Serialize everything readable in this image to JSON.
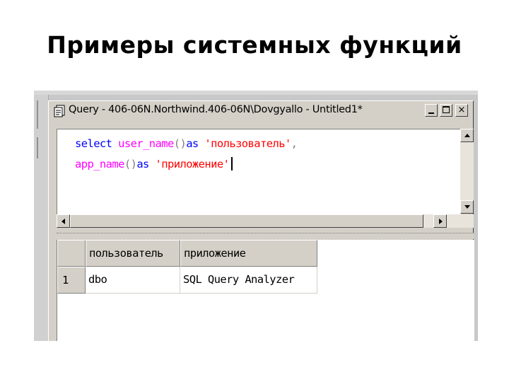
{
  "slide": {
    "title": "Примеры системных функций"
  },
  "window": {
    "title": "Query - 406-06N.Northwind.406-06N\\Dovgyallo - Untitled1*",
    "controls": {
      "minimize": "_",
      "maximize": "□",
      "close": "×"
    }
  },
  "editor": {
    "line1": {
      "kw1": "select",
      "fn1": "user_name",
      "paren1": "()",
      "kw2": "as",
      "str1": "'пользователь'",
      "punct": ","
    },
    "line2": {
      "fn2": "app_name",
      "paren2": "()",
      "kw3": "as",
      "str2": "'приложение'"
    }
  },
  "results": {
    "columns": [
      "пользователь",
      "приложение"
    ],
    "rows": [
      {
        "num": "1",
        "cells": [
          "dbo",
          "SQL Query Analyzer"
        ]
      }
    ]
  },
  "colors": {
    "keyword": "#0000ff",
    "function": "#ff00ff",
    "string": "#ff0000",
    "chrome": "#d4d0c8"
  }
}
